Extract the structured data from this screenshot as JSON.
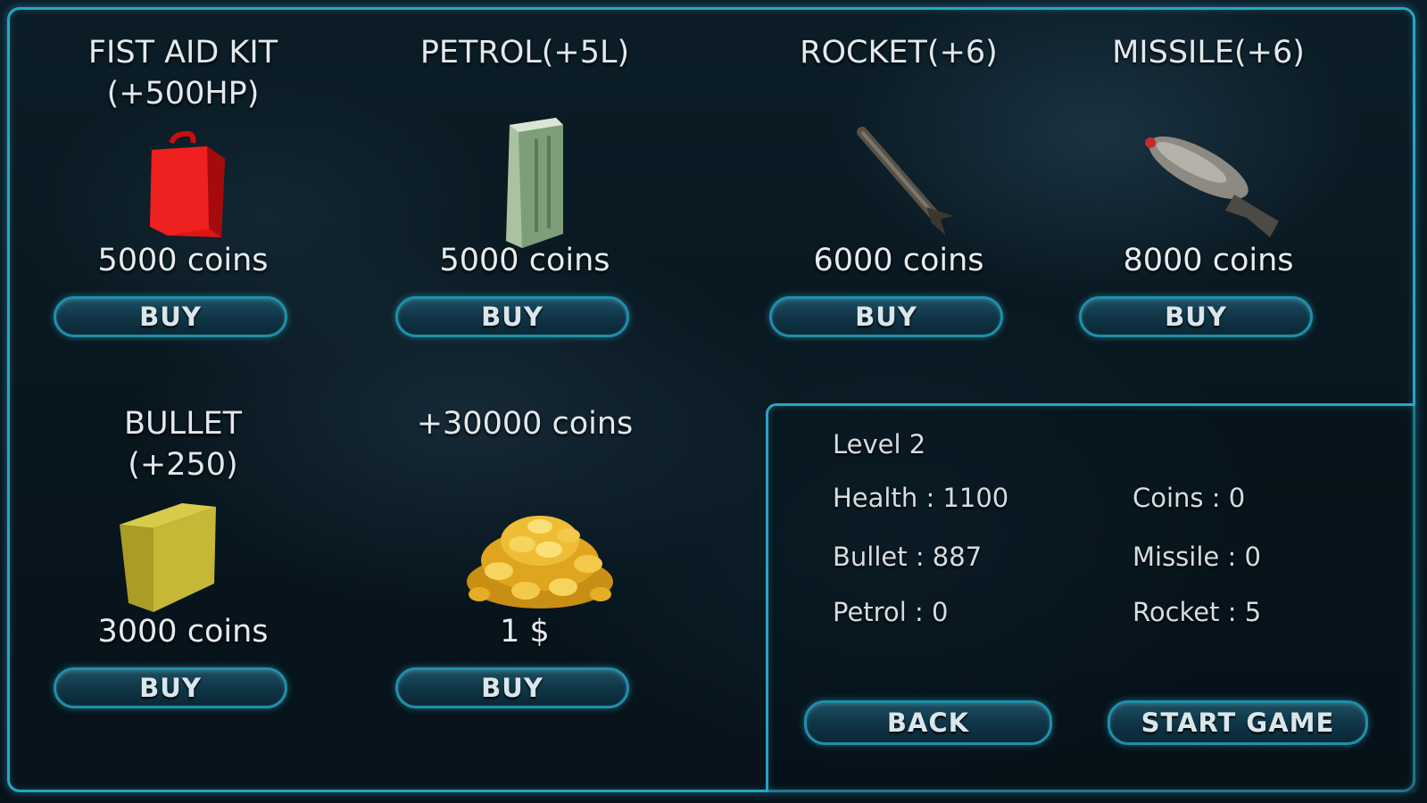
{
  "items": [
    {
      "title": "FIST AID KIT\n(+500HP)",
      "price": "5000 coins",
      "button": "BUY",
      "icon": "first-aid-kit-icon"
    },
    {
      "title": "PETROL(+5L)",
      "price": "5000 coins",
      "button": "BUY",
      "icon": "petrol-can-icon"
    },
    {
      "title": "ROCKET(+6)",
      "price": "6000 coins",
      "button": "BUY",
      "icon": "rocket-icon"
    },
    {
      "title": "MISSILE(+6)",
      "price": "8000 coins",
      "button": "BUY",
      "icon": "missile-icon"
    },
    {
      "title": "BULLET\n(+250)",
      "price": "3000 coins",
      "button": "BUY",
      "icon": "ammo-box-icon"
    },
    {
      "title": "+30000 coins",
      "price": "1 $",
      "button": "BUY",
      "icon": "coin-pile-icon"
    }
  ],
  "stats": {
    "level": "Level 2",
    "health": "Health : 1100",
    "coins": "Coins : 0",
    "bullet": "Bullet : 887",
    "missile": "Missile : 0",
    "petrol": "Petrol : 0",
    "rocket": "Rocket : 5"
  },
  "buttons": {
    "back": "BACK",
    "start": "START GAME"
  },
  "colors": {
    "accent": "#2aa5c1",
    "button_fill": "#0f3445",
    "first_aid": "#e01414",
    "ammo_box": "#b7aa2a",
    "gold": "#e8b52a"
  }
}
